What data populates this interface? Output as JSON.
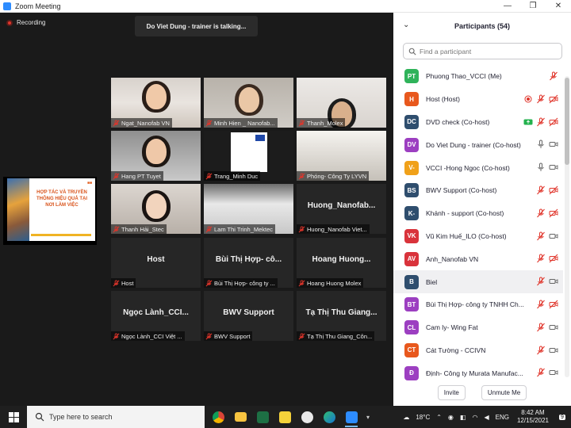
{
  "window": {
    "title": "Zoom Meeting",
    "minimize": "—",
    "restore": "❐",
    "close": "✕"
  },
  "meeting": {
    "recording_label": "Recording",
    "talking_banner": "Do Viet Dung - trainer is talking...",
    "shared_screen_text": "HỢP TÁC VÀ TRUYỀN THÔNG HIỆU QUẢ TẠI NƠI LÀM VIỆC",
    "tiles": [
      {
        "label": "Ngat_Nanofab VN",
        "big": "",
        "video": true
      },
      {
        "label": "Minh Hien _ Nanofab...",
        "big": "",
        "video": true
      },
      {
        "label": "Thanh_Molex",
        "big": "",
        "video": true
      },
      {
        "label": "Hang PT Tuyet",
        "big": "",
        "video": true
      },
      {
        "label": "Trang_Minh Duc",
        "big": "",
        "video": true
      },
      {
        "label": "Phóng- Công Ty LYVN",
        "big": "",
        "video": true
      },
      {
        "label": "Thanh Hải_Stec",
        "big": "",
        "video": true
      },
      {
        "label": "Lam Thi Trinh_Mektec",
        "big": "",
        "video": true
      },
      {
        "label": "Huong_Nanofab Viet...",
        "big": "Huong_Nanofab...",
        "video": false
      },
      {
        "label": "Host",
        "big": "Host",
        "video": false
      },
      {
        "label": "Bùi Thị Hợp- công ty ...",
        "big": "Bùi Thị Hợp- cô...",
        "video": false
      },
      {
        "label": "Hoang Huong Molex",
        "big": "Hoang Huong...",
        "video": false
      },
      {
        "label": "Ngọc Lành_CCI Việt ...",
        "big": "Ngọc Lành_CCI...",
        "video": false
      },
      {
        "label": "BWV Support",
        "big": "BWV Support",
        "video": false
      },
      {
        "label": "Tạ Thị Thu Giang_Côn...",
        "big": "Tạ Thị Thu Giang...",
        "video": false
      }
    ]
  },
  "participants": {
    "title": "Participants (54)",
    "search_placeholder": "Find a participant",
    "items": [
      {
        "initials": "PT",
        "color": "#2fb35a",
        "name": "Phuong Thao_VCCI (Me)",
        "icons": [
          "mic-muted"
        ]
      },
      {
        "initials": "H",
        "color": "#e8581d",
        "name": "Host (Host)",
        "icons": [
          "record",
          "mic-muted",
          "video-off"
        ]
      },
      {
        "initials": "DC",
        "color": "#2f4e6e",
        "name": "DVD check (Co-host)",
        "icons": [
          "share",
          "mic-muted",
          "video-off"
        ]
      },
      {
        "initials": "DV",
        "color": "#9c3fc1",
        "name": "Do Viet Dung - trainer (Co-host)",
        "icons": [
          "mic-on",
          "video-on"
        ]
      },
      {
        "initials": "V-",
        "color": "#f0a11a",
        "name": "VCCI -Hong Ngoc (Co-host)",
        "icons": [
          "mic-on",
          "video-on"
        ]
      },
      {
        "initials": "BS",
        "color": "#2f4e6e",
        "name": "BWV Support (Co-host)",
        "icons": [
          "mic-muted",
          "video-off"
        ]
      },
      {
        "initials": "K-",
        "color": "#2f4e6e",
        "name": "Khánh - support (Co-host)",
        "icons": [
          "mic-muted",
          "video-off"
        ]
      },
      {
        "initials": "VK",
        "color": "#d9333b",
        "name": "Vũ Kim Huế_ILO (Co-host)",
        "icons": [
          "mic-muted",
          "video-on"
        ]
      },
      {
        "initials": "AV",
        "color": "#d9333b",
        "name": "Anh_Nanofab VN",
        "icons": [
          "mic-muted",
          "video-off"
        ]
      },
      {
        "initials": "B",
        "color": "#2f4e6e",
        "name": "Biel",
        "icons": [
          "mic-muted",
          "video-on"
        ]
      },
      {
        "initials": "BT",
        "color": "#9c3fc1",
        "name": "Bùi Thị Hợp- công ty TNHH Ch...",
        "icons": [
          "mic-muted",
          "video-off"
        ]
      },
      {
        "initials": "CL",
        "color": "#9c3fc1",
        "name": "Cam ly- Wing Fat",
        "icons": [
          "mic-muted",
          "video-on"
        ]
      },
      {
        "initials": "CT",
        "color": "#e8581d",
        "name": "Cát Tường - CCIVN",
        "icons": [
          "mic-muted",
          "video-on"
        ]
      },
      {
        "initials": "Đ",
        "color": "#9c3fc1",
        "name": "Định- Công ty Murata Manufac...",
        "icons": [
          "mic-muted",
          "video-on"
        ]
      }
    ],
    "invite_label": "Invite",
    "mute_me_label": "Unmute Me"
  },
  "taskbar": {
    "search_placeholder": "Type here to search",
    "temperature": "18°C",
    "language": "ENG",
    "time": "8:42 AM",
    "date": "12/15/2021",
    "notification_count": "9"
  }
}
